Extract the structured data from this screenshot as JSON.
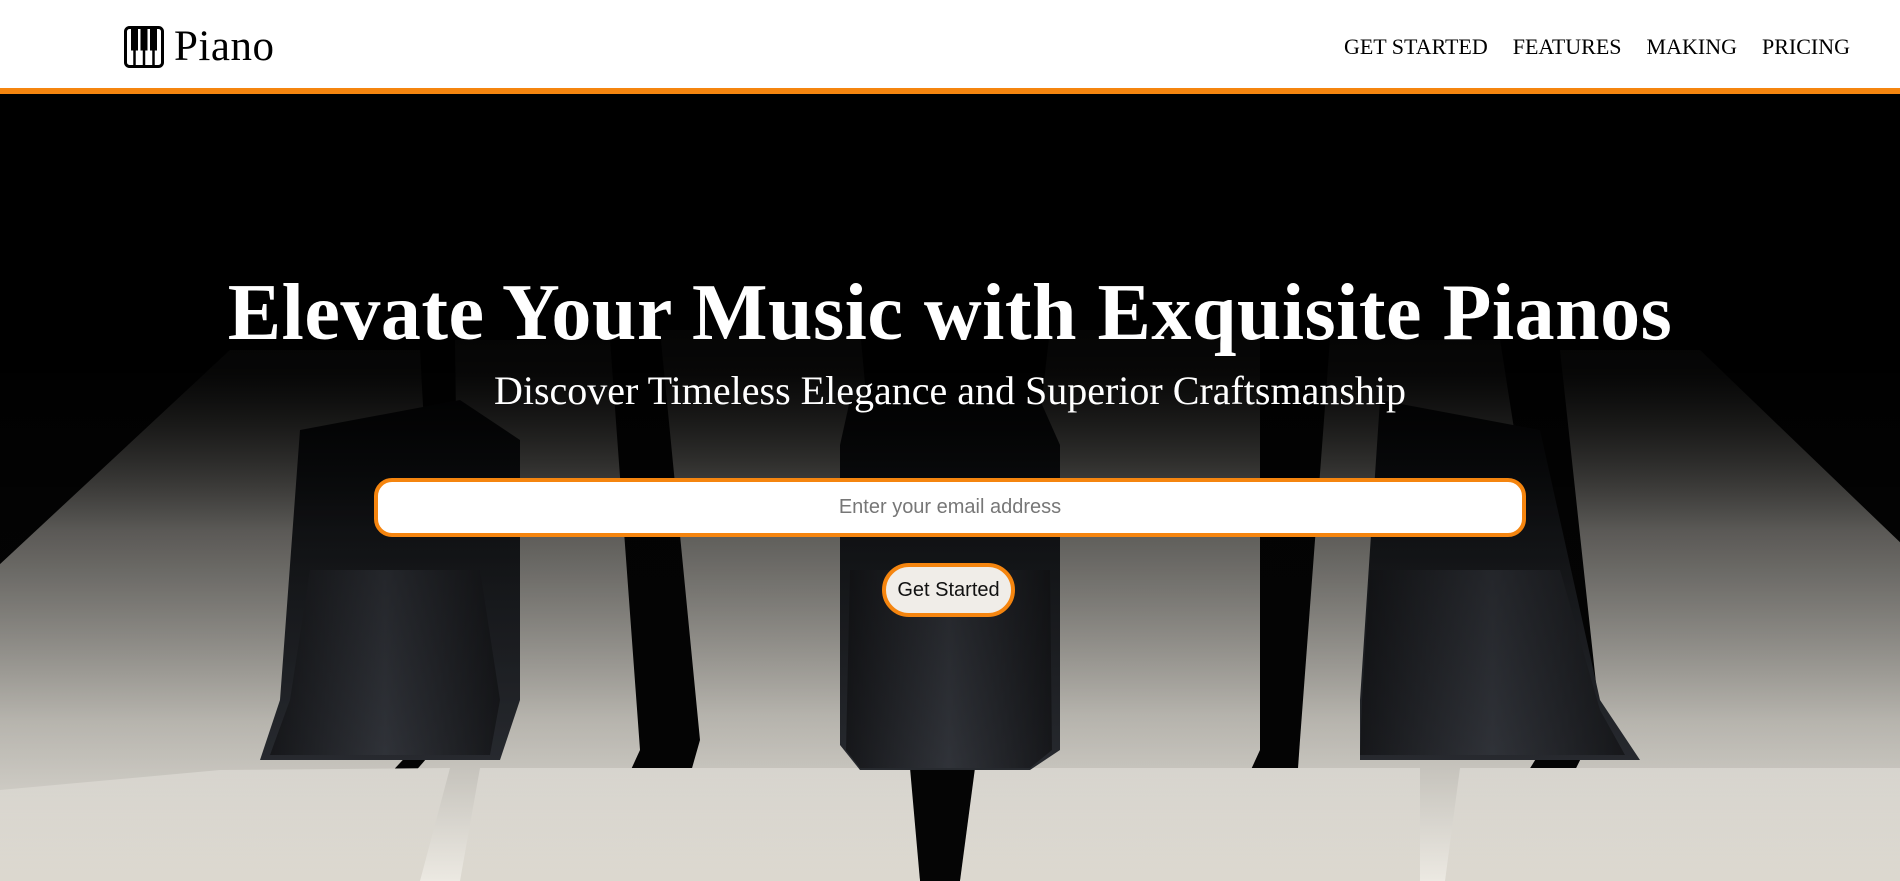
{
  "header": {
    "brand_name": "Piano",
    "brand_icon": "piano-keys-icon",
    "accent_color": "#f5850f",
    "nav": [
      {
        "label": "GET STARTED"
      },
      {
        "label": "FEATURES"
      },
      {
        "label": "MAKING"
      },
      {
        "label": "PRICING"
      }
    ]
  },
  "hero": {
    "title": "Elevate Your Music with Exquisite Pianos",
    "subtitle": "Discover Timeless Elegance and Superior Craftsmanship",
    "email_placeholder": "Enter your email address",
    "email_value": "",
    "cta_label": "Get Started",
    "background": "piano-keys-closeup-photo"
  }
}
